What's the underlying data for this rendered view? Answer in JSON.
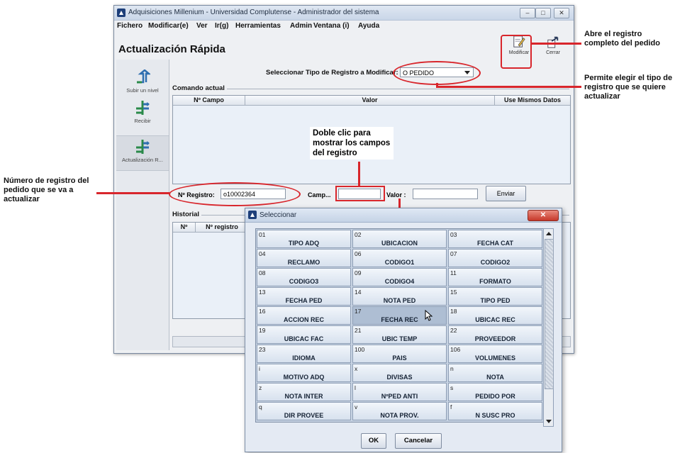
{
  "window": {
    "title": "Adquisiciones Millenium - Universidad Complutense - Administrador del sistema",
    "menus": [
      "Fichero",
      "Modificar(e)",
      "Ver",
      "Ir(g)",
      "Herramientas",
      "Admin",
      "Ventana (i)",
      "Ayuda"
    ],
    "page_title": "Actualización Rápida"
  },
  "toolbar": {
    "modificar": "Modificar",
    "cerrar": "Cerrar"
  },
  "sidebar": {
    "items": [
      {
        "label": "Subir un nivel",
        "icon": "up-level-icon"
      },
      {
        "label": "Recibir",
        "icon": "receive-icon"
      },
      {
        "label": "Actualización R...",
        "icon": "quick-update-icon"
      }
    ]
  },
  "record_type": {
    "label": "Seleccionar Tipo de Registro a Modificar:",
    "value": "O PEDIDO"
  },
  "comando_actual": {
    "group_label": "Comando actual",
    "columns": [
      "Nº Campo",
      "Valor",
      "Use Mismos Datos"
    ]
  },
  "inputs": {
    "registro_label": "Nº Registro:",
    "registro_value": "o10002364",
    "campo_label": "Camp...",
    "valor_label": "Valor :",
    "enviar": "Enviar"
  },
  "historial": {
    "group_label": "Historial",
    "columns": [
      "Nº",
      "Nº registro"
    ]
  },
  "annotations": {
    "hint": "Doble clic para mostrar los campos del registro",
    "modificar": "Abre el registro completo del pedido",
    "tipo": "Permite elegir el tipo de registro que se quiere actualizar",
    "registro": "Número de registro del pedido que se va a actualizar"
  },
  "dialog": {
    "title": "Seleccionar",
    "ok": "OK",
    "cancel": "Cancelar",
    "fields": [
      {
        "code": "01",
        "name": "TIPO ADQ"
      },
      {
        "code": "02",
        "name": "UBICACION"
      },
      {
        "code": "03",
        "name": "FECHA CAT"
      },
      {
        "code": "04",
        "name": "RECLAMO"
      },
      {
        "code": "06",
        "name": "CODIGO1"
      },
      {
        "code": "07",
        "name": "CODIGO2"
      },
      {
        "code": "08",
        "name": "CODIGO3"
      },
      {
        "code": "09",
        "name": "CODIGO4"
      },
      {
        "code": "11",
        "name": "FORMATO"
      },
      {
        "code": "13",
        "name": "FECHA PED"
      },
      {
        "code": "14",
        "name": "NOTA PED"
      },
      {
        "code": "15",
        "name": "TIPO PED"
      },
      {
        "code": "16",
        "name": "ACCION REC"
      },
      {
        "code": "17",
        "name": "FECHA REC"
      },
      {
        "code": "18",
        "name": "UBICAC REC"
      },
      {
        "code": "19",
        "name": "UBICAC FAC"
      },
      {
        "code": "21",
        "name": "UBIC TEMP"
      },
      {
        "code": "22",
        "name": "PROVEEDOR"
      },
      {
        "code": "23",
        "name": "IDIOMA"
      },
      {
        "code": "100",
        "name": "PAIS"
      },
      {
        "code": "106",
        "name": "VOLUMENES"
      },
      {
        "code": "i",
        "name": "MOTIVO ADQ"
      },
      {
        "code": "x",
        "name": "DIVISAS"
      },
      {
        "code": "n",
        "name": "NOTA"
      },
      {
        "code": "z",
        "name": "NOTA INTER"
      },
      {
        "code": "l",
        "name": "NºPED ANTI"
      },
      {
        "code": "s",
        "name": "PEDIDO POR"
      },
      {
        "code": "q",
        "name": "DIR PROVEE"
      },
      {
        "code": "v",
        "name": "NOTA PROV."
      },
      {
        "code": "f",
        "name": "N SUSC PRO"
      }
    ],
    "selected_index": 13
  },
  "colors": {
    "annotation_red": "#d8262c",
    "selected_cell": "#aebed3"
  }
}
